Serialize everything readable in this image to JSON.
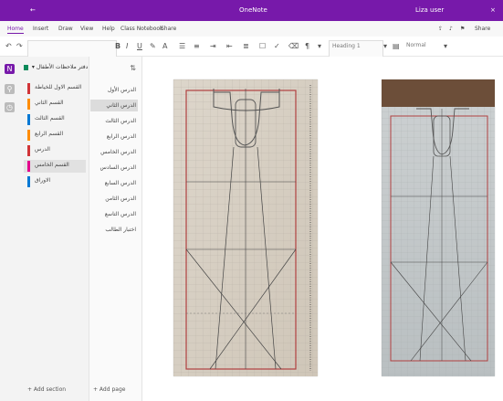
{
  "titlebar": {
    "app_title": "OneNote",
    "user": "Liza user"
  },
  "menubar": {
    "items": [
      "Home",
      "Insert",
      "Draw",
      "View",
      "Help",
      "Class Notebook",
      "Share"
    ]
  },
  "toolbar": {
    "font_size": "Heading 1",
    "style": "Normal",
    "undo": "↶",
    "redo": "↷"
  },
  "notebook": {
    "name": "دفتر ملاحظات الأطفال"
  },
  "sections": [
    {
      "label": "القسم الاول للخياطة",
      "color": "#d13438"
    },
    {
      "label": "القسم الثاني",
      "color": "#ff8c00"
    },
    {
      "label": "القسم الثالث",
      "color": "#0078d4"
    },
    {
      "label": "القسم الرابع",
      "color": "#ff8c00"
    },
    {
      "label": "الدرس",
      "color": "#d13438"
    },
    {
      "label": "القسم الخامس",
      "color": "#e3008c"
    },
    {
      "label": "الاوراق",
      "color": "#0078d4"
    }
  ],
  "pages": [
    "الدرس الأول",
    "الدرس الثاني",
    "الدرس الثالث",
    "الدرس الرابع",
    "الدرس الخامس",
    "الدرس السادس",
    "الدرس السابع",
    "الدرس الثامن",
    "الدرس التاسع",
    "اختبار الطالب"
  ],
  "footer": {
    "add_section": "+ Add section",
    "add_page": "+ Add page"
  },
  "colors": {
    "accent": "#7719aa",
    "pattern_line": "#b04040",
    "paper": "#d8d0c4"
  }
}
